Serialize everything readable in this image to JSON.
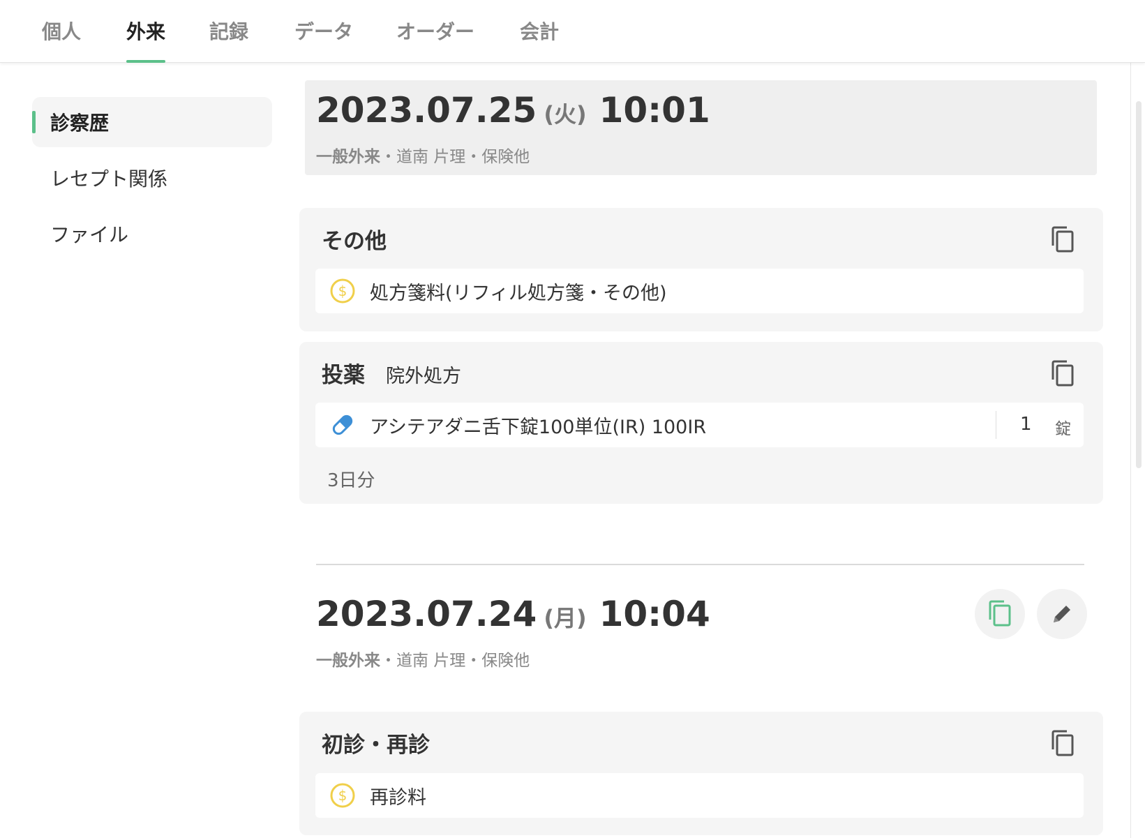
{
  "tabs": [
    {
      "label": "個人"
    },
    {
      "label": "外来"
    },
    {
      "label": "記録"
    },
    {
      "label": "データ"
    },
    {
      "label": "オーダー"
    },
    {
      "label": "会計"
    }
  ],
  "active_tab": "外来",
  "sidebar": {
    "items": [
      {
        "label": "診察歴"
      },
      {
        "label": "レセプト関係"
      },
      {
        "label": "ファイル"
      }
    ],
    "active": "診察歴"
  },
  "visits": [
    {
      "date": "2023.07.25",
      "weekday": "(火)",
      "time": "10:01",
      "visit_type": "一般外来",
      "meta": "・道南 片理・保険他",
      "cards": [
        {
          "title": "その他",
          "subtitle": "",
          "items": [
            {
              "icon": "coin-icon",
              "label": "処方箋料(リフィル処方箋・その他)"
            }
          ]
        },
        {
          "title": "投薬",
          "subtitle": "院外処方",
          "items": [
            {
              "icon": "pill-icon",
              "label": "アシテアダニ舌下錠100単位(IR) 100IR",
              "quantity": "1",
              "unit": "錠"
            }
          ],
          "duration": "3日分"
        }
      ]
    },
    {
      "date": "2023.07.24",
      "weekday": "(月)",
      "time": "10:04",
      "visit_type": "一般外来",
      "meta": "・道南 片理・保険他",
      "cards": [
        {
          "title": "初診・再診",
          "subtitle": "",
          "items": [
            {
              "icon": "coin-icon",
              "label": "再診料"
            }
          ]
        }
      ]
    }
  ],
  "colors": {
    "accent": "#5cc08a",
    "coin": "#f0cf4a",
    "pill": "#3d8fd6",
    "panel": "#f5f5f5"
  }
}
